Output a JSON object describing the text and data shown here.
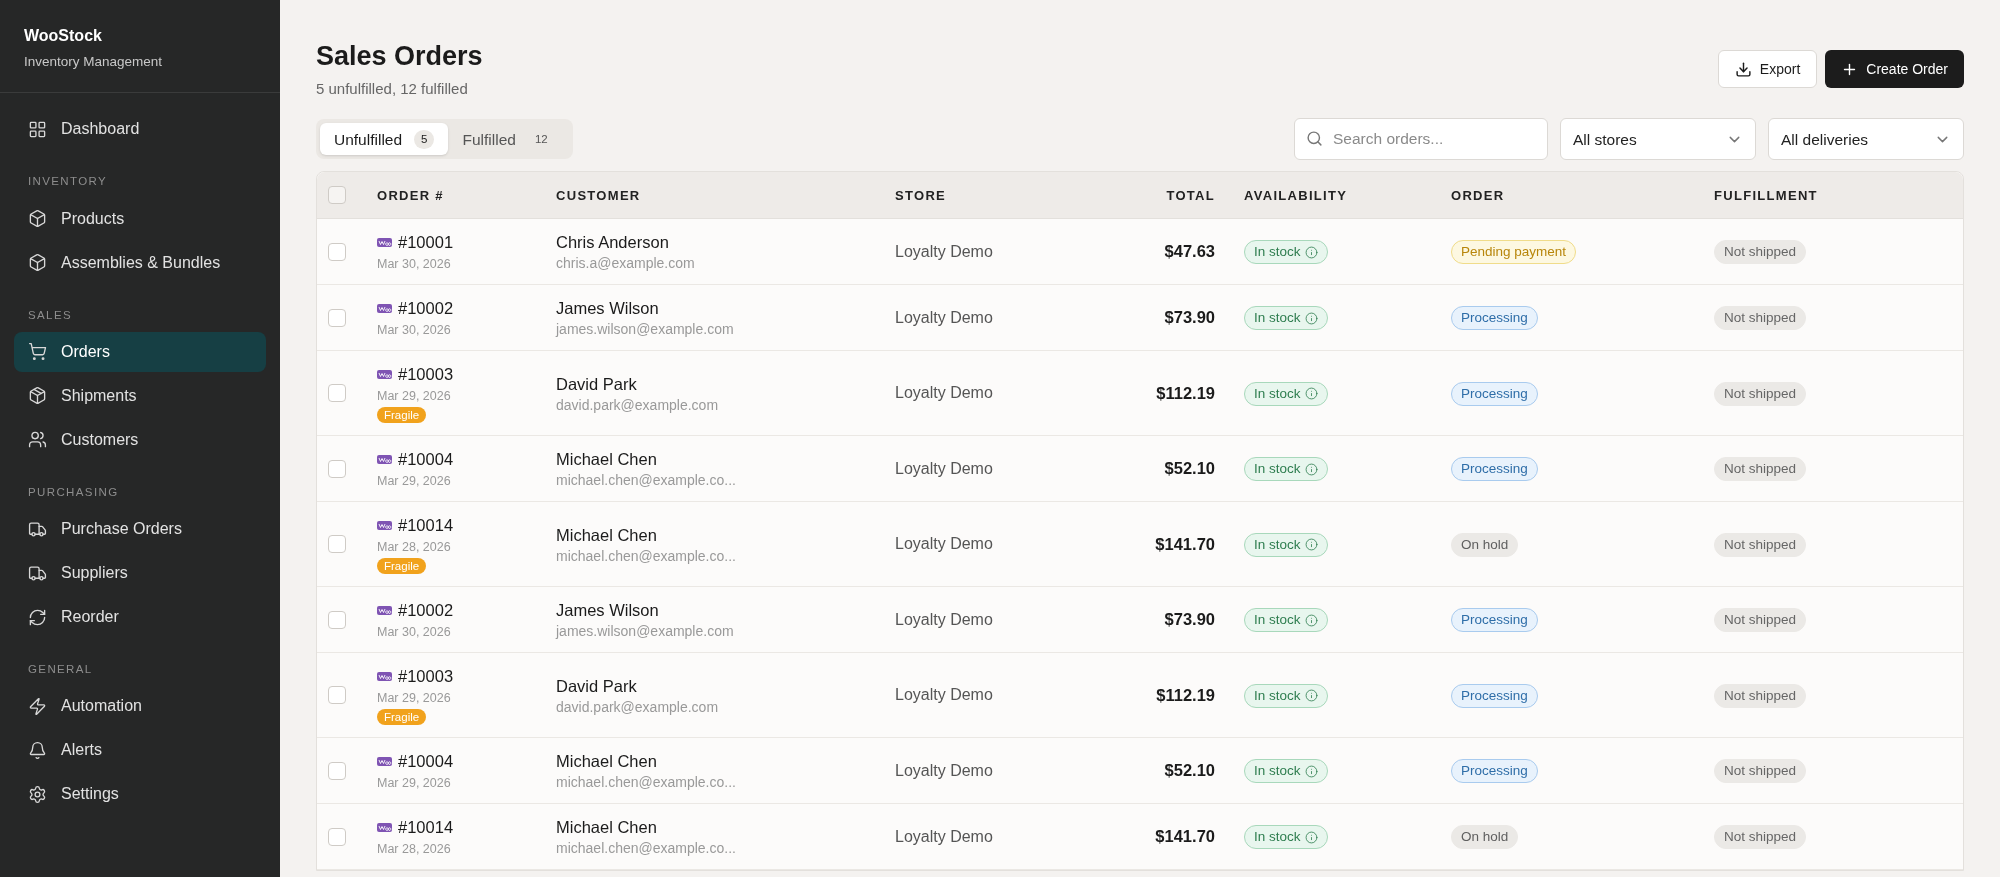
{
  "sidebar": {
    "brand": "WooStock",
    "subtitle": "Inventory Management",
    "sections": [
      {
        "items": [
          {
            "label": "Dashboard",
            "selected": false
          }
        ]
      },
      {
        "label": "INVENTORY",
        "items": [
          {
            "label": "Products",
            "selected": false
          },
          {
            "label": "Assemblies & Bundles",
            "selected": false
          }
        ]
      },
      {
        "label": "SALES",
        "items": [
          {
            "label": "Orders",
            "selected": true
          },
          {
            "label": "Shipments",
            "selected": false
          },
          {
            "label": "Customers",
            "selected": false
          }
        ]
      },
      {
        "label": "PURCHASING",
        "items": [
          {
            "label": "Purchase Orders",
            "selected": false
          },
          {
            "label": "Suppliers",
            "selected": false
          },
          {
            "label": "Reorder",
            "selected": false
          }
        ]
      },
      {
        "label": "GENERAL",
        "items": [
          {
            "label": "Automation",
            "selected": false
          },
          {
            "label": "Alerts",
            "selected": false
          },
          {
            "label": "Settings",
            "selected": false
          }
        ]
      }
    ]
  },
  "header": {
    "title": "Sales Orders",
    "subtitle": "5 unfulfilled, 12 fulfilled",
    "buttons": [
      {
        "label": "Export",
        "kind": "secondary"
      },
      {
        "label": "Create Order",
        "kind": "primary"
      }
    ]
  },
  "tabs": [
    {
      "label": "Unfulfilled",
      "count": "5",
      "selected": true
    },
    {
      "label": "Fulfilled",
      "count": "12",
      "selected": false
    }
  ],
  "search": {
    "placeholder": "Search orders..."
  },
  "filters": [
    "All stores",
    "All deliveries"
  ],
  "table": {
    "select_all": {
      "checked": false
    },
    "columns": [
      "ORDER #",
      "CUSTOMER",
      "STORE",
      "TOTAL",
      "AVAILABILITY",
      "ORDER",
      "FULFILLMENT"
    ],
    "rows": [
      {
        "checked": false,
        "order": "#10001",
        "date": "Mar 30, 2026",
        "customer": "Chris Anderson",
        "email": "chris.a@example.com",
        "store": "Loyalty Demo",
        "total": "$47.63",
        "availability": {
          "label": "In stock",
          "kind": "ok"
        },
        "status": {
          "label": "Pending payment",
          "kind": "pending"
        },
        "fulfillment": "Not shipped"
      },
      {
        "checked": false,
        "order": "#10002",
        "date": "Mar 30, 2026",
        "customer": "James Wilson",
        "email": "james.wilson@example.com",
        "store": "Loyalty Demo",
        "total": "$73.90",
        "availability": {
          "label": "In stock",
          "kind": "ok"
        },
        "status": {
          "label": "Processing",
          "kind": "processing"
        },
        "fulfillment": "Not shipped"
      },
      {
        "checked": false,
        "order": "#10003",
        "date": "Mar 29, 2026",
        "tag": "Fragile",
        "customer": "David Park",
        "email": "david.park@example.com",
        "store": "Loyalty Demo",
        "total": "$112.19",
        "availability": {
          "label": "In stock",
          "kind": "ok"
        },
        "status": {
          "label": "Processing",
          "kind": "processing"
        },
        "fulfillment": "Not shipped"
      },
      {
        "checked": false,
        "order": "#10004",
        "date": "Mar 29, 2026",
        "customer": "Michael Chen",
        "email": "michael.chen@example.co...",
        "store": "Loyalty Demo",
        "total": "$52.10",
        "availability": {
          "label": "In stock",
          "kind": "ok"
        },
        "status": {
          "label": "Processing",
          "kind": "processing"
        },
        "fulfillment": "Not shipped"
      },
      {
        "checked": false,
        "order": "#10014",
        "date": "Mar 28, 2026",
        "tag": "Fragile",
        "customer": "Michael Chen",
        "email": "michael.chen@example.co...",
        "store": "Loyalty Demo",
        "total": "$141.70",
        "availability": {
          "label": "In stock",
          "kind": "ok"
        },
        "status": {
          "label": "On hold",
          "kind": "hold"
        },
        "fulfillment": "Not shipped"
      },
      {
        "checked": false,
        "order": "#10002",
        "date": "Mar 30, 2026",
        "customer": "James Wilson",
        "email": "james.wilson@example.com",
        "store": "Loyalty Demo",
        "total": "$73.90",
        "availability": {
          "label": "In stock",
          "kind": "ok"
        },
        "status": {
          "label": "Processing",
          "kind": "processing"
        },
        "fulfillment": "Not shipped"
      },
      {
        "checked": false,
        "order": "#10003",
        "date": "Mar 29, 2026",
        "tag": "Fragile",
        "customer": "David Park",
        "email": "david.park@example.com",
        "store": "Loyalty Demo",
        "total": "$112.19",
        "availability": {
          "label": "In stock",
          "kind": "ok"
        },
        "status": {
          "label": "Processing",
          "kind": "processing"
        },
        "fulfillment": "Not shipped"
      },
      {
        "checked": false,
        "order": "#10004",
        "date": "Mar 29, 2026",
        "customer": "Michael Chen",
        "email": "michael.chen@example.co...",
        "store": "Loyalty Demo",
        "total": "$52.10",
        "availability": {
          "label": "In stock",
          "kind": "ok"
        },
        "status": {
          "label": "Processing",
          "kind": "processing"
        },
        "fulfillment": "Not shipped"
      },
      {
        "checked": false,
        "order": "#10014",
        "date": "Mar 28, 2026",
        "customer": "Michael Chen",
        "email": "michael.chen@example.co...",
        "store": "Loyalty Demo",
        "total": "$141.70",
        "availability": {
          "label": "In stock",
          "kind": "ok"
        },
        "status": {
          "label": "On hold",
          "kind": "hold"
        },
        "fulfillment": "Not shipped"
      }
    ]
  }
}
